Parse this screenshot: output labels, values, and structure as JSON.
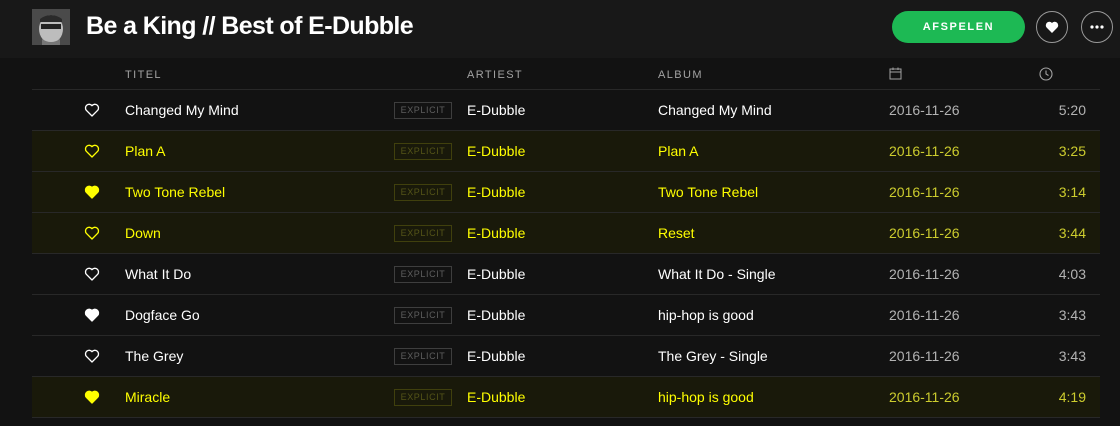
{
  "playlist": {
    "title": "Be a King // Best of E-Dubble",
    "play_label": "AFSPELEN"
  },
  "columns": {
    "title": "TITEL",
    "artist": "ARTIEST",
    "album": "ALBUM",
    "date_icon": "calendar-icon",
    "duration_icon": "clock-icon"
  },
  "colors": {
    "accent": "#1db954",
    "highlight_text": "#ffff00",
    "background": "#121212"
  },
  "tracks": [
    {
      "title": "Changed My Mind",
      "explicit": "EXPLICIT",
      "artist": "E-Dubble",
      "album": "Changed My Mind",
      "date": "2016-11-26",
      "duration": "5:20",
      "liked": false,
      "highlighted": false
    },
    {
      "title": "Plan A",
      "explicit": "EXPLICIT",
      "artist": "E-Dubble",
      "album": "Plan A",
      "date": "2016-11-26",
      "duration": "3:25",
      "liked": false,
      "highlighted": true
    },
    {
      "title": "Two Tone Rebel",
      "explicit": "EXPLICIT",
      "artist": "E-Dubble",
      "album": "Two Tone Rebel",
      "date": "2016-11-26",
      "duration": "3:14",
      "liked": true,
      "highlighted": true
    },
    {
      "title": "Down",
      "explicit": "EXPLICIT",
      "artist": "E-Dubble",
      "album": "Reset",
      "date": "2016-11-26",
      "duration": "3:44",
      "liked": false,
      "highlighted": true
    },
    {
      "title": "What It Do",
      "explicit": "EXPLICIT",
      "artist": "E-Dubble",
      "album": "What It Do - Single",
      "date": "2016-11-26",
      "duration": "4:03",
      "liked": false,
      "highlighted": false
    },
    {
      "title": "Dogface Go",
      "explicit": "EXPLICIT",
      "artist": "E-Dubble",
      "album": "hip-hop is good",
      "date": "2016-11-26",
      "duration": "3:43",
      "liked": true,
      "highlighted": false
    },
    {
      "title": "The Grey",
      "explicit": "EXPLICIT",
      "artist": "E-Dubble",
      "album": "The Grey - Single",
      "date": "2016-11-26",
      "duration": "3:43",
      "liked": false,
      "highlighted": false
    },
    {
      "title": "Miracle",
      "explicit": "EXPLICIT",
      "artist": "E-Dubble",
      "album": "hip-hop is good",
      "date": "2016-11-26",
      "duration": "4:19",
      "liked": true,
      "highlighted": true
    }
  ]
}
